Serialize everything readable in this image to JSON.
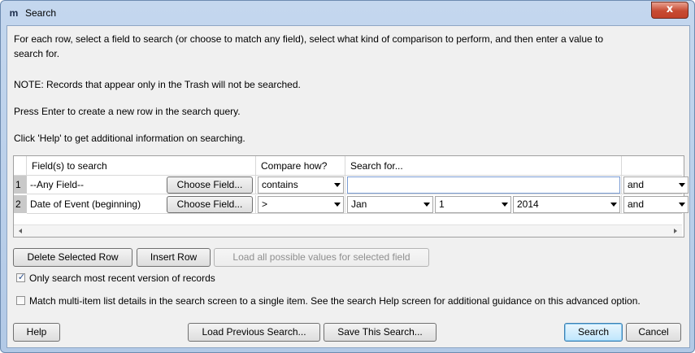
{
  "window": {
    "icon": "m",
    "title": "Search",
    "close_glyph": "x"
  },
  "instructions": {
    "line1": "For each row, select a field to search (or choose to match any field), select what kind of comparison to perform, and then enter a value to",
    "line2": "search for.",
    "note": "NOTE: Records that appear only in the Trash will not be searched.",
    "enter": "Press Enter to create a new row in the search query.",
    "help": "Click 'Help' to get additional information on searching."
  },
  "grid": {
    "headers": {
      "fields": "Field(s) to search",
      "compare": "Compare how?",
      "search_for": "Search for..."
    },
    "rows": [
      {
        "number": "1",
        "field": "--Any Field--",
        "choose_label": "Choose Field...",
        "compare": "contains",
        "value": "",
        "connector": "and"
      },
      {
        "number": "2",
        "field": "Date of Event (beginning)",
        "choose_label": "Choose Field...",
        "compare": ">",
        "month": "Jan",
        "day": "1",
        "year": "2014",
        "connector": "and"
      }
    ]
  },
  "actions": {
    "delete_row": "Delete Selected Row",
    "insert_row": "Insert Row",
    "load_values": "Load all possible values for selected field"
  },
  "options": {
    "recent_version": {
      "label": "Only search most recent version of records",
      "checked": true,
      "mark": "✓"
    },
    "multi_item": {
      "label": "Match multi-item list details in the search screen to a single item. See the search Help screen for additional guidance on this advanced option.",
      "checked": false
    }
  },
  "footer": {
    "help": "Help",
    "load_previous": "Load Previous Search...",
    "save_search": "Save This Search...",
    "search": "Search",
    "cancel": "Cancel"
  },
  "colors": {
    "title_bar": "#b9cfea",
    "dialog_bg": "#f0f0f0",
    "close_button": "#c74a32",
    "row_header": "#c9c9c9"
  }
}
